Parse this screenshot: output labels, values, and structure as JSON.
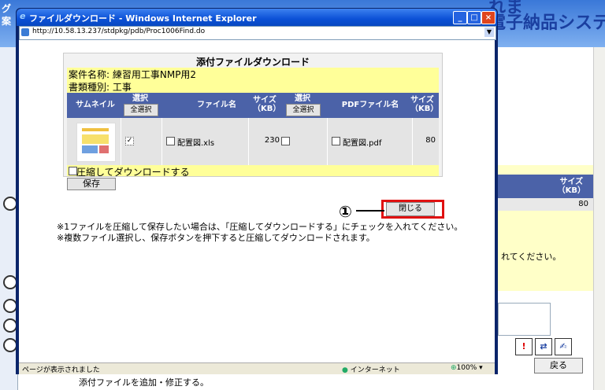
{
  "background": {
    "app_title": "れま\n電子納品システム",
    "left_g": "グ",
    "left_an": "案",
    "table_size_header": "サイズ\n（KB）",
    "table_size_value": "80",
    "note_text": "れてください。",
    "back_label": "戻る",
    "bottom_text": "添付ファイルを追加・修正する。",
    "icons": [
      "!",
      "⇄",
      "✍"
    ]
  },
  "window": {
    "title": "ファイルダウンロード - Windows Internet Explorer",
    "url": "http://10.58.13.237/stdpkg/pdb/Proc1006Find.do",
    "status_text": "ページが表示されました",
    "zone": "インターネット",
    "zoom": "100%"
  },
  "dialog": {
    "title": "添付ファイルダウンロード",
    "project_name": "案件名称: 練習用工事NMP用2",
    "doc_type": "書類種別: 工事",
    "columns": {
      "thumbnail": "サムネイル",
      "select": "選択",
      "select_all": "全選択",
      "file_name": "ファイル名",
      "size": "サイズ\n（KB）",
      "pdf_select": "選択",
      "pdf_select_all": "全選択",
      "pdf_name": "PDFファイル名",
      "pdf_size": "サイズ\n（KB）"
    },
    "row": {
      "file_name": "配置図.xls",
      "size": "230",
      "pdf_name": "配置図.pdf",
      "pdf_size": "80"
    },
    "zip_label": "圧縮してダウンロードする",
    "save_label": "保存",
    "close_label": "閉じる",
    "callout": "①",
    "note1": "※1ファイルを圧縮して保存したい場合は、「圧縮してダウンロードする」にチェックを入れてください。",
    "note2": "※複数ファイル選択し、保存ボタンを押下すると圧縮してダウンロードされます。"
  }
}
